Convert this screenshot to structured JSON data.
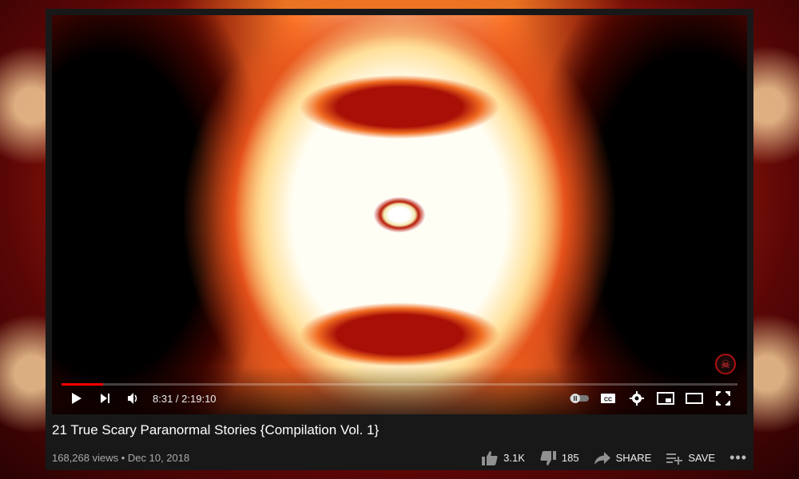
{
  "player": {
    "current_time": "8:31",
    "separator": " / ",
    "duration": "2:19:10",
    "progress_fraction": 0.061,
    "accent_color": "#ff0000"
  },
  "video": {
    "title": "21 True Scary Paranormal Stories {Compilation Vol. 1}",
    "views": "168,268 views",
    "dot": " • ",
    "date": "Dec 10, 2018"
  },
  "actions": {
    "like_count": "3.1K",
    "dislike_count": "185",
    "share_label": "SHARE",
    "save_label": "SAVE",
    "more_label": "•••"
  },
  "icons": [
    "play-icon",
    "next-icon",
    "volume-icon",
    "autoplay-toggle-icon",
    "captions-icon",
    "settings-icon",
    "miniplayer-icon",
    "theater-icon",
    "fullscreen-icon",
    "like-icon",
    "dislike-icon",
    "share-icon",
    "save-playlist-icon",
    "more-icon"
  ]
}
